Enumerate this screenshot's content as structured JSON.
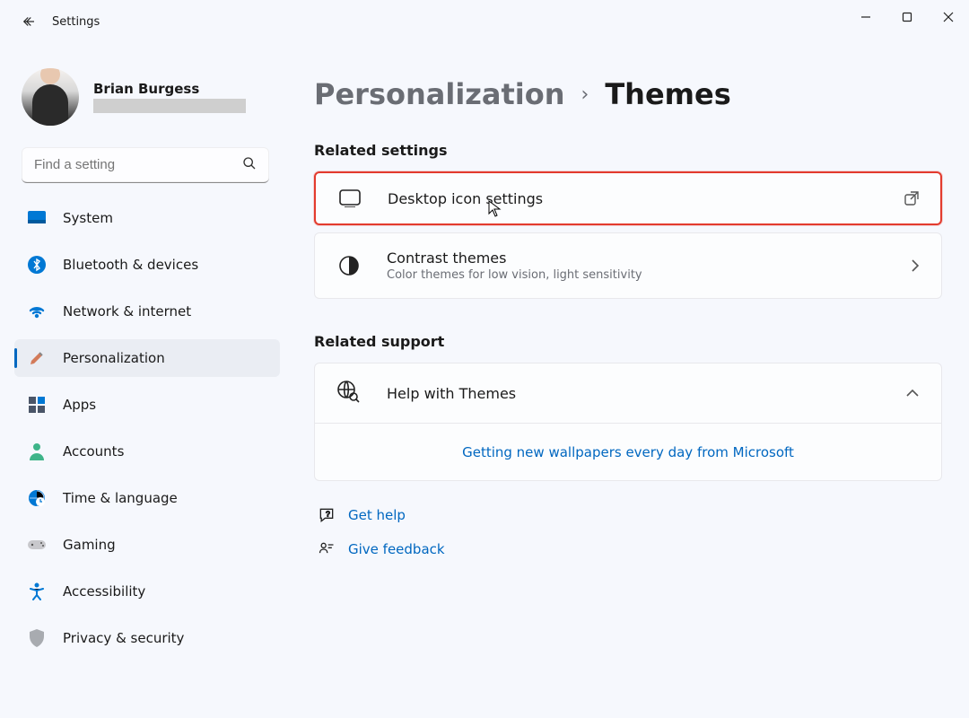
{
  "window": {
    "app_title": "Settings"
  },
  "profile": {
    "name": "Brian Burgess"
  },
  "search": {
    "placeholder": "Find a setting"
  },
  "nav": {
    "items": [
      {
        "label": "System"
      },
      {
        "label": "Bluetooth & devices"
      },
      {
        "label": "Network & internet"
      },
      {
        "label": "Personalization"
      },
      {
        "label": "Apps"
      },
      {
        "label": "Accounts"
      },
      {
        "label": "Time & language"
      },
      {
        "label": "Gaming"
      },
      {
        "label": "Accessibility"
      },
      {
        "label": "Privacy & security"
      }
    ]
  },
  "breadcrumb": {
    "parent": "Personalization",
    "current": "Themes"
  },
  "sections": {
    "related_settings_title": "Related settings",
    "desktop_icon": {
      "title": "Desktop icon settings"
    },
    "contrast": {
      "title": "Contrast themes",
      "subtitle": "Color themes for low vision, light sensitivity"
    },
    "related_support_title": "Related support",
    "help_with_themes": "Help with Themes",
    "wallpapers_link": "Getting new wallpapers every day from Microsoft"
  },
  "footer": {
    "get_help": "Get help",
    "feedback": "Give feedback"
  }
}
